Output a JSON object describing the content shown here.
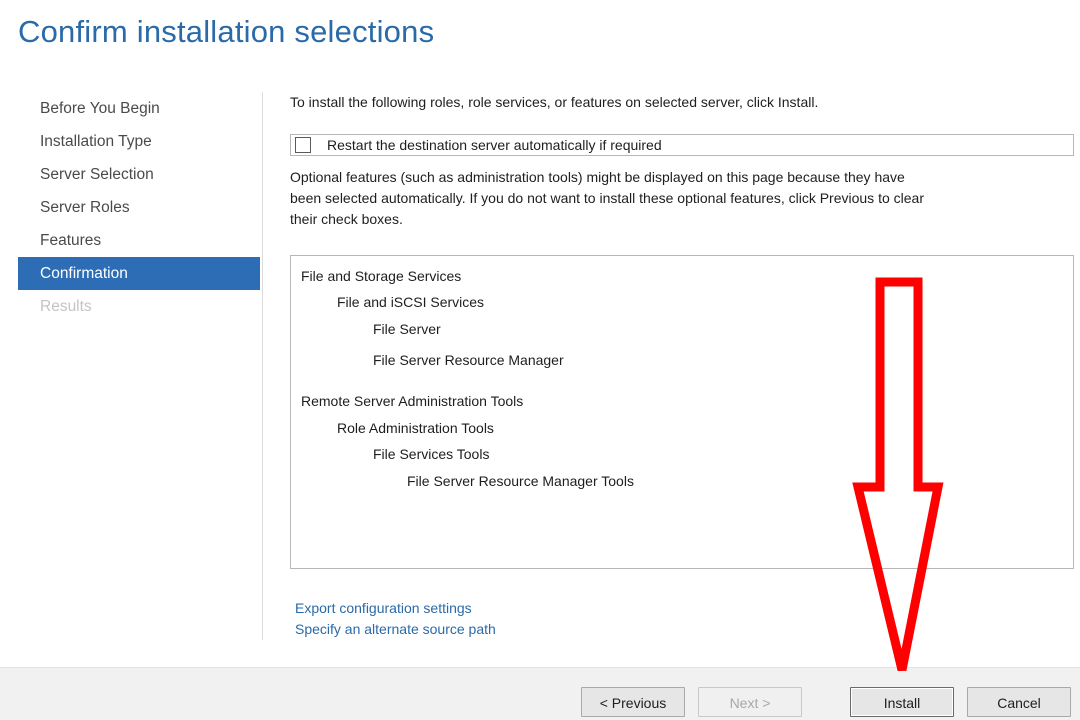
{
  "page": {
    "title": "Confirm installation selections"
  },
  "nav": {
    "items": [
      {
        "label": "Before You Begin"
      },
      {
        "label": "Installation Type"
      },
      {
        "label": "Server Selection"
      },
      {
        "label": "Server Roles"
      },
      {
        "label": "Features"
      },
      {
        "label": "Confirmation",
        "state": "active"
      },
      {
        "label": "Results",
        "state": "disabled"
      }
    ]
  },
  "content": {
    "intro": "To install the following roles, role services, or features on selected server, click Install.",
    "restart_checkbox": {
      "label": "Restart the destination server automatically if required",
      "checked": false
    },
    "optional_note_lines": [
      "Optional features (such as administration tools) might be displayed on this page because they have",
      "been selected automatically. If you do not want to install these optional features, click Previous to clear",
      "their check boxes."
    ],
    "selections": [
      {
        "label": "File and Storage Services",
        "level": 0
      },
      {
        "label": "File and iSCSI Services",
        "level": 1
      },
      {
        "label": "File Server",
        "level": 2
      },
      {
        "label": "File Server Resource Manager",
        "level": 2
      },
      {
        "label": "Remote Server Administration Tools",
        "level": 0
      },
      {
        "label": "Role Administration Tools",
        "level": 1
      },
      {
        "label": "File Services Tools",
        "level": 2
      },
      {
        "label": "File Server Resource Manager Tools",
        "level": 3
      }
    ],
    "links": {
      "export": "Export configuration settings",
      "alternate_source": "Specify an alternate source path"
    }
  },
  "footer": {
    "previous": "< Previous",
    "next": "Next >",
    "install": "Install",
    "cancel": "Cancel"
  },
  "annotation": {
    "type": "arrow-down",
    "color": "#ff0000",
    "points_to": "Install"
  },
  "colors": {
    "accent": "#2d6db5",
    "title": "#2a6aa8",
    "annotation": "#ff0000"
  }
}
